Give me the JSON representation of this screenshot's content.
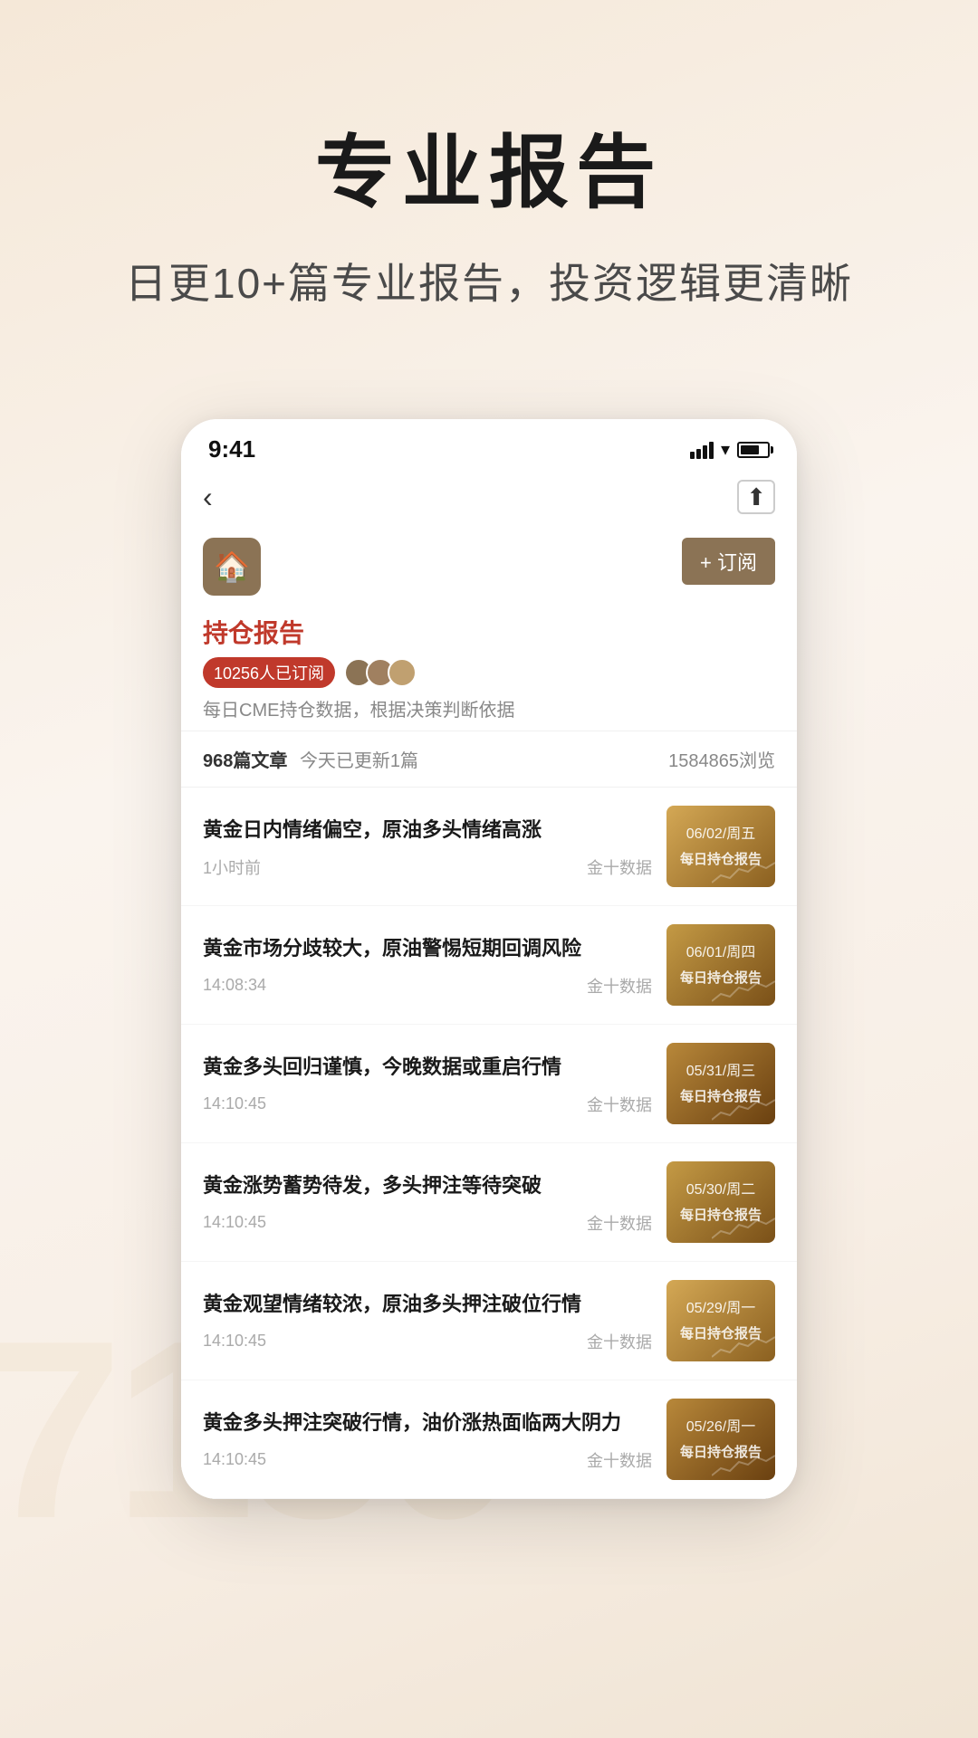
{
  "page": {
    "title": "专业报告",
    "subtitle": "日更10+篇专业报告，投资逻辑更清晰"
  },
  "status_bar": {
    "time": "9:41",
    "signal": "signal-icon",
    "wifi": "wifi-icon",
    "battery": "battery-icon"
  },
  "nav": {
    "back_label": "‹",
    "share_label": "⬆"
  },
  "channel": {
    "logo_icon": "🏠",
    "subscribe_btn": "+ 订阅",
    "name": "持仓报告",
    "subscriber_badge": "10256人已订阅",
    "desc": "每日CME持仓数据，根据决策判断依据"
  },
  "stats": {
    "article_count": "968篇文章",
    "update_today": "今天已更新1篇",
    "views": "1584865浏览"
  },
  "articles": [
    {
      "title": "黄金日内情绪偏空，原油多头情绪高涨",
      "time": "1小时前",
      "source": "金十数据",
      "thumb_date": "06/02/周五",
      "thumb_label": "每日持仓报告",
      "thumb_class": "thumb-bg-1"
    },
    {
      "title": "黄金市场分歧较大，原油警惕短期回调风险",
      "time": "14:08:34",
      "source": "金十数据",
      "thumb_date": "06/01/周四",
      "thumb_label": "每日持仓报告",
      "thumb_class": "thumb-bg-2"
    },
    {
      "title": "黄金多头回归谨慎，今晚数据或重启行情",
      "time": "14:10:45",
      "source": "金十数据",
      "thumb_date": "05/31/周三",
      "thumb_label": "每日持仓报告",
      "thumb_class": "thumb-bg-3"
    },
    {
      "title": "黄金涨势蓄势待发，多头押注等待突破",
      "time": "14:10:45",
      "source": "金十数据",
      "thumb_date": "05/30/周二",
      "thumb_label": "每日持仓报告",
      "thumb_class": "thumb-bg-4"
    },
    {
      "title": "黄金观望情绪较浓，原油多头押注破位行情",
      "time": "14:10:45",
      "source": "金十数据",
      "thumb_date": "05/29/周一",
      "thumb_label": "每日持仓报告",
      "thumb_class": "thumb-bg-5"
    },
    {
      "title": "黄金多头押注突破行情，油价涨热面临两大阴力",
      "time": "14:10:45",
      "source": "金十数据",
      "thumb_date": "05/26/周一",
      "thumb_label": "每日持仓报告",
      "thumb_class": "thumb-bg-6"
    }
  ],
  "watermark": "7180"
}
